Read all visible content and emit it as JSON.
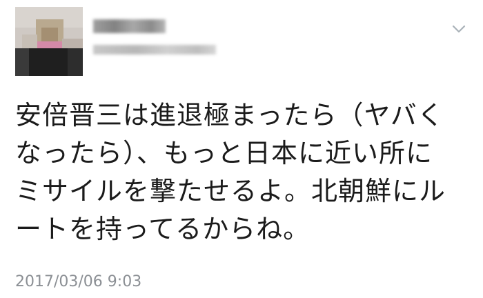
{
  "user": {
    "avatar_icon": "pixelated-avatar",
    "display_name": "",
    "handle": ""
  },
  "menu": {
    "icon": "chevron-down-icon"
  },
  "tweet": {
    "lines": [
      "安倍晋三は進退極まったら（ヤバく",
      "なったら）、もっと日本に近い所に",
      "ミサイルを撃たせるよ。北朝鮮にル",
      "ートを持ってるからね。"
    ],
    "timestamp": "2017/03/06 9:03"
  },
  "colors": {
    "text": "#1b1b1b",
    "timestamp": "#8b8f94",
    "chevron": "#a9b1b8"
  }
}
